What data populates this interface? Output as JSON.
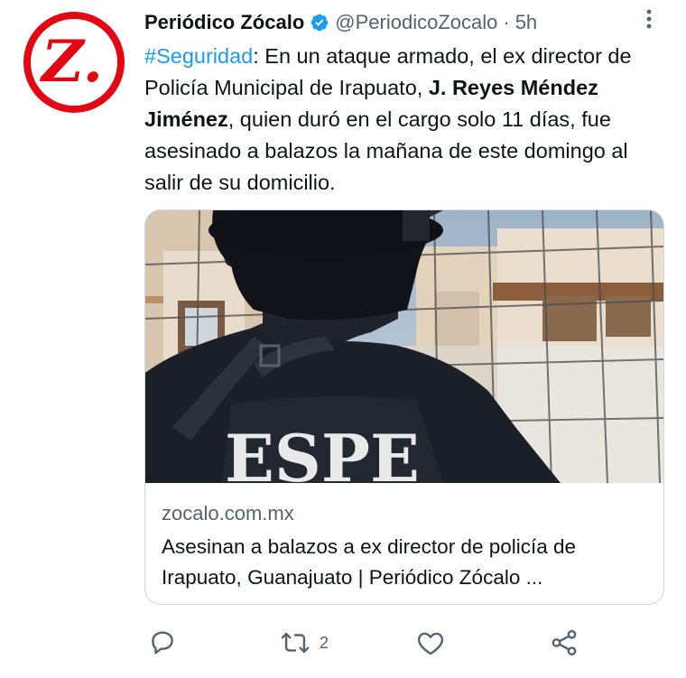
{
  "author": {
    "name": "Periódico Zócalo",
    "handle": "@PeriodicoZocalo",
    "separator": "·",
    "time": "5h",
    "avatar_letter": "Z."
  },
  "tweet": {
    "hashtag": "#Seguridad",
    "text_1": ": En un ataque armado, el ex director de Policía Municipal de Irapuato, ",
    "bold_name": "J. Reyes Méndez Jiménez",
    "text_2": ", quien duró en el cargo solo 11 días, fue asesinado a balazos la mañana de este domingo al salir de su domicilio."
  },
  "card": {
    "image_vest_text": "ESPE",
    "domain": "zocalo.com.mx",
    "title": "Asesinan a balazos a ex director de policía de Irapuato, Guanajuato | Periódico Zócalo ..."
  },
  "actions": {
    "reply_count": "",
    "retweet_count": "2",
    "like_count": ""
  },
  "colors": {
    "brand_red": "#e30613",
    "link_blue": "#1d9bf0",
    "muted": "#536471",
    "text": "#0f1419",
    "border": "#cfd9de"
  },
  "icons": {
    "verified": "verified-badge-icon",
    "more": "more-dots-icon",
    "reply": "reply-icon",
    "retweet": "retweet-icon",
    "like": "heart-icon",
    "share": "share-icon"
  }
}
